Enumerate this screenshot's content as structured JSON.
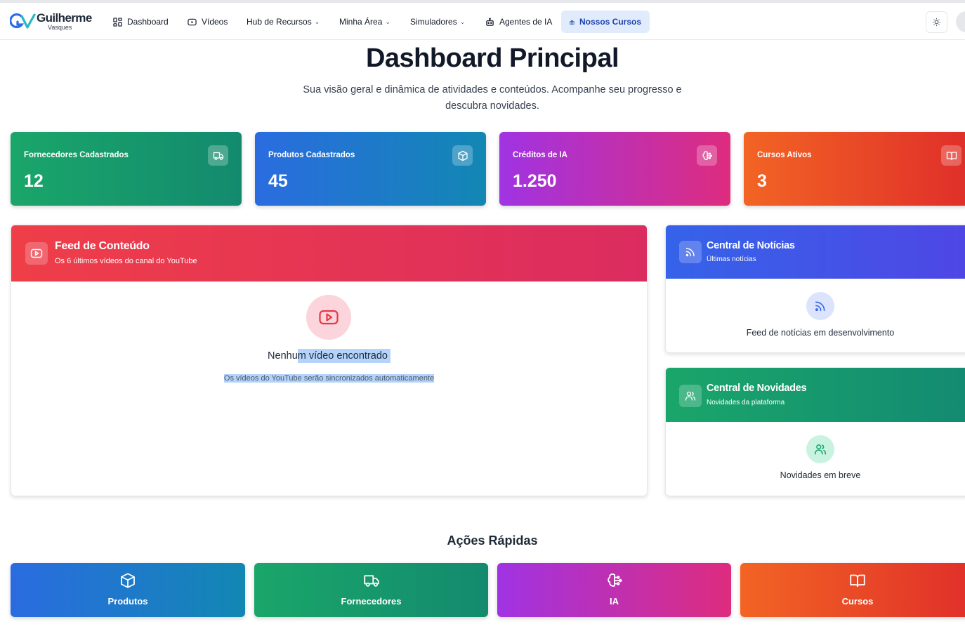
{
  "brand": {
    "name": "Guilherme",
    "sub": "Vasques"
  },
  "nav": {
    "dashboard": "Dashboard",
    "videos": "Vídeos",
    "hub": "Hub de Recursos",
    "minha_area": "Minha Área",
    "simuladores": "Simuladores",
    "agentes": "Agentes de IA",
    "cursos": "Nossos Cursos"
  },
  "header": {
    "title": "Dashboard Principal",
    "subtitle": "Sua visão geral e dinâmica de atividades e conteúdos. Acompanhe seu progresso e descubra novidades."
  },
  "stats": [
    {
      "label": "Fornecedores Cadastrados",
      "value": "12",
      "icon": "truck-icon"
    },
    {
      "label": "Produtos Cadastrados",
      "value": "45",
      "icon": "box-icon"
    },
    {
      "label": "Créditos de IA",
      "value": "1.250",
      "icon": "brain-icon"
    },
    {
      "label": "Cursos Ativos",
      "value": "3",
      "icon": "book-icon"
    }
  ],
  "feed": {
    "title": "Feed de Conteúdo",
    "subtitle": "Os 6 últimos vídeos do canal do YouTube",
    "empty_title_a": "Nenhu",
    "empty_title_b": "m vídeo encontrado",
    "empty_sub": "Os vídeos do YouTube serão sincronizados automaticamente"
  },
  "news": {
    "title": "Central de Notícias",
    "subtitle": "Últimas notícias",
    "empty": "Feed de notícias em desenvolvimento"
  },
  "novidades": {
    "title": "Central de Novidades",
    "subtitle": "Novidades da plataforma",
    "empty": "Novidades em breve"
  },
  "quick_actions": {
    "title": "Ações Rápidas",
    "items": [
      {
        "label": "Produtos",
        "icon": "box-icon"
      },
      {
        "label": "Fornecedores",
        "icon": "truck-icon"
      },
      {
        "label": "IA",
        "icon": "brain-icon"
      },
      {
        "label": "Cursos",
        "icon": "book-icon"
      }
    ]
  },
  "colors": {
    "green": "#1aa66a",
    "blue": "#2a6ce0",
    "purple": "#a033e3",
    "orange": "#f26424",
    "feed_red": "#ef3e48",
    "news_blue": "#3563e9",
    "novidades_green": "#1aa66a"
  }
}
